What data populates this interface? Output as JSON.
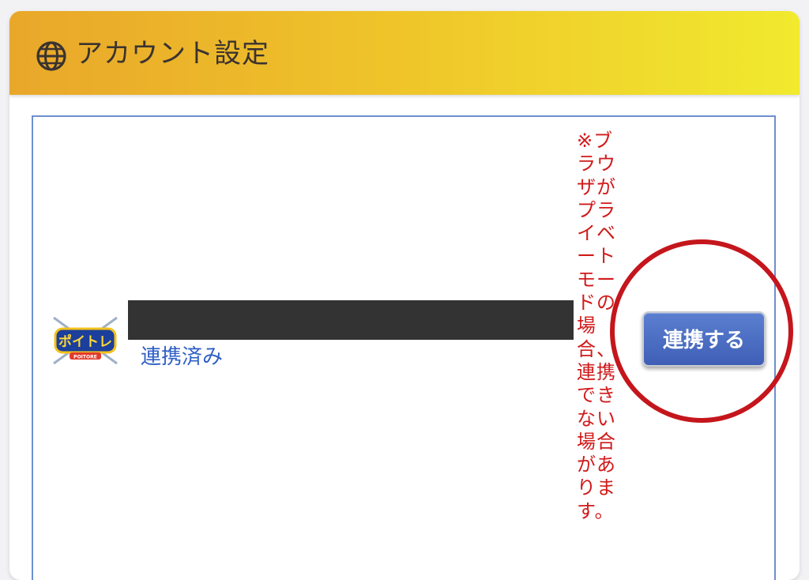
{
  "header": {
    "title": "アカウント設定",
    "icon": "globe-icon"
  },
  "account_row": {
    "logo_text": "ポイトレ",
    "logo_subtext": "POITORE",
    "status_label": "連携済み",
    "warning": "※ブラウザがプライベートモードの場合、連携できない場合があります。",
    "button_label": "連携する"
  },
  "colors": {
    "header_gradient_start": "#e9a72a",
    "header_gradient_end": "#f1ea2e",
    "status_link": "#2f5fc6",
    "warning": "#d11a1a",
    "button": "#3f5fb6",
    "highlight": "#c4161c"
  }
}
